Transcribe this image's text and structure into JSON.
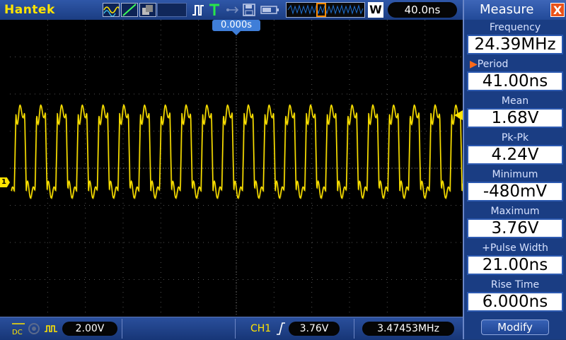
{
  "brand": "Hantek",
  "topbar": {
    "timebase": "40.0ns",
    "memory_mode": "W"
  },
  "screen": {
    "trigger_position": "0.000s",
    "channel_marker": "1",
    "grid": true,
    "trace_color": "#ffe400",
    "waveform": {
      "period_divisions": 0.55,
      "high_level_v": 3.76,
      "low_level_v": -0.48,
      "volts_per_div": 2.0
    }
  },
  "bottom": {
    "coupling_label": "DC",
    "volts_per_div": "2.00V",
    "trigger_channel": "CH1",
    "trigger_level": "3.76V",
    "trigger_frequency": "3.47453MHz"
  },
  "measure": {
    "title": "Measure",
    "close": "X",
    "items": [
      {
        "label": "Frequency",
        "value": "24.39MHz",
        "selected": false
      },
      {
        "label": "Period",
        "value": "41.00ns",
        "selected": true
      },
      {
        "label": "Mean",
        "value": "1.68V",
        "selected": false
      },
      {
        "label": "Pk-Pk",
        "value": "4.24V",
        "selected": false
      },
      {
        "label": "Minimum",
        "value": "-480mV",
        "selected": false
      },
      {
        "label": "Maximum",
        "value": "3.76V",
        "selected": false
      },
      {
        "label": "+Pulse Width",
        "value": "21.00ns",
        "selected": false
      },
      {
        "label": "Rise Time",
        "value": "6.000ns",
        "selected": false
      }
    ],
    "modify_label": "Modify"
  },
  "colors": {
    "accent_yellow": "#ffe400",
    "panel_blue": "#1a3d83",
    "close_orange": "#e8521a"
  }
}
